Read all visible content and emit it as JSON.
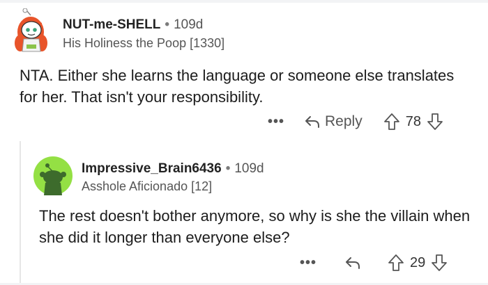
{
  "comments": [
    {
      "username": "NUT-me-SHELL",
      "separator": "•",
      "age": "109d",
      "flair": "His Holiness the Poop [1330]",
      "body": "NTA. Either she learns the language or someone else translates for her. That isn't your responsibility.",
      "more": "•••",
      "reply_label": "Reply",
      "score": "78",
      "icons": {
        "more": "more-dots-icon",
        "reply": "reply-arrow-icon",
        "upvote": "upvote-icon",
        "downvote": "downvote-icon"
      }
    },
    {
      "username": "Impressive_Brain6436",
      "separator": "•",
      "age": "109d",
      "flair": "Asshole Aficionado [12]",
      "body": "The rest doesn't bother anymore, so why is she the villain when she did it longer than everyone else?",
      "more": "•••",
      "score": "29",
      "icons": {
        "more": "more-dots-icon",
        "reply": "reply-arrow-icon",
        "upvote": "upvote-icon",
        "downvote": "downvote-icon"
      }
    }
  ],
  "colors": {
    "text": "#1c1c1c",
    "meta": "#555555",
    "avatar2_bg": "#94e044",
    "avatar1_hair": "#e8542a",
    "thread_line": "#e6e6e6"
  }
}
